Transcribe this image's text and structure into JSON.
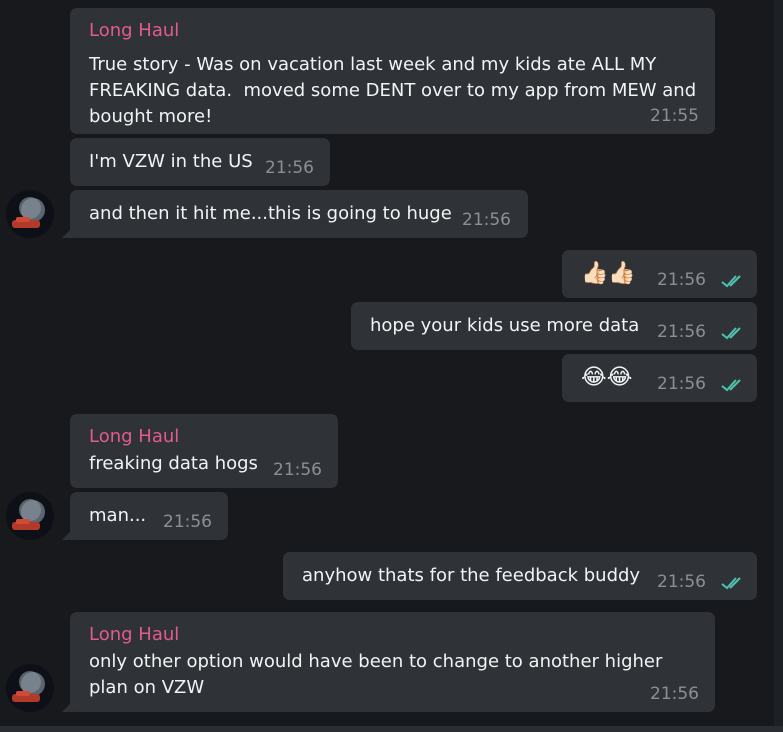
{
  "messages": [
    {
      "sender": "Long Haul",
      "lines": [
        "True story - Was on vacation last week and my kids ate ALL MY",
        "FREAKING data.  moved some DENT over to my app from MEW and",
        "bought more!"
      ],
      "time": "21:55"
    },
    {
      "text": "I'm VZW in the US",
      "time": "21:56"
    },
    {
      "text": "and then it hit me...this is going to huge",
      "time": "21:56"
    },
    {
      "text": "👍🏻👍🏻",
      "time": "21:56",
      "read": true
    },
    {
      "text": "hope your kids use more data",
      "time": "21:56",
      "read": true
    },
    {
      "text": "😂😂",
      "time": "21:56",
      "read": true
    },
    {
      "sender": "Long Haul",
      "text": "freaking data hogs",
      "time": "21:56"
    },
    {
      "text": "man...",
      "time": "21:56"
    },
    {
      "text": "anyhow thats for the feedback buddy",
      "time": "21:56",
      "read": true
    },
    {
      "sender": "Long Haul",
      "lines": [
        "only other option would have been to change to another higher",
        "plan on VZW"
      ],
      "time": "21:56"
    }
  ],
  "colors": {
    "background": "#17191c",
    "bubble": "#2f3338",
    "sender": "#e35b8c",
    "text": "#f2f3f4",
    "time": "#8a9096",
    "read_check": "#4fc3b1"
  },
  "icons": {
    "read_receipt": "double-check-icon",
    "avatar": "user-avatar"
  }
}
